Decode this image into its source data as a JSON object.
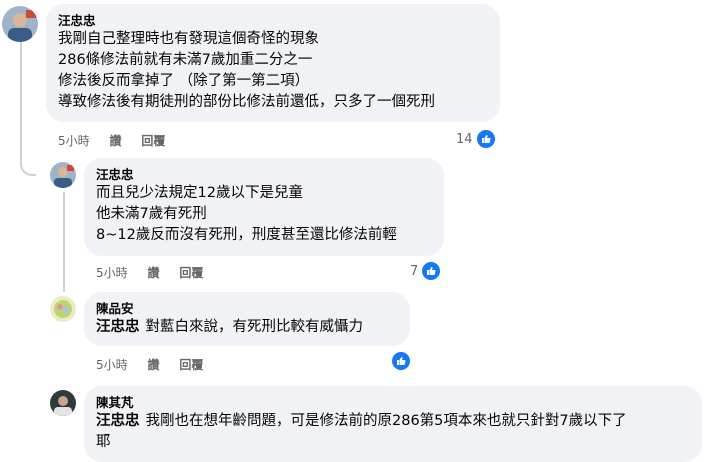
{
  "comments": [
    {
      "author": "汪忠忠",
      "lines": [
        "我剛自己整理時也有發現這個奇怪的現象",
        "286條修法前就有未滿7歲加重二分之一",
        "修法後反而拿掉了 （除了第一第二項）",
        "導致修法後有期徒刑的部份比修法前還低，只多了一個死刑"
      ],
      "time": "5小時",
      "reply_1": "讚",
      "reply_2": "回覆",
      "reaction_count": "14",
      "reaction_icon": "like-icon"
    },
    {
      "author": "汪忠忠",
      "lines": [
        "而且兒少法規定12歲以下是兒童",
        "他未滿7歲有死刑",
        "8~12歲反而沒有死刑，刑度甚至還比修法前輕"
      ],
      "time": "5小時",
      "reply_1": "讚",
      "reply_2": "回覆",
      "reaction_count": "7",
      "reaction_icon": "like-icon"
    },
    {
      "author": "陳品安",
      "mention": "汪忠忠",
      "lines": [
        "對藍白來說，有死刑比較有威懾力"
      ],
      "time": "5小時",
      "reply_1": "讚",
      "reply_2": "回覆",
      "reaction_count": "",
      "reaction_icon": "like-icon"
    },
    {
      "author": "陳其芃",
      "mention": "汪忠忠",
      "lines": [
        "我剛也在想年齡問題，可是修法前的原286第5項本來也就只針對7歲以下了",
        "耶"
      ]
    }
  ],
  "colors": {
    "bubble": "#f0f2f5",
    "like": "#1877f2",
    "meta": "#65676b"
  }
}
